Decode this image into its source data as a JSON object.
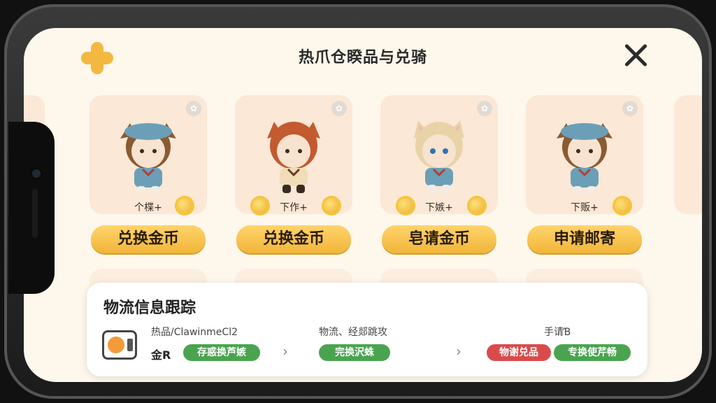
{
  "header": {
    "title": "热爪仓睽品与兑骑"
  },
  "cards": [
    {
      "coin_label": "个楪+",
      "button_label": "兑换金币",
      "hair": "#8a5a33",
      "hat": true
    },
    {
      "coin_label": "下作+",
      "button_label": "兑换金币",
      "hair": "#c35a30",
      "hat": false
    },
    {
      "coin_label": "下嫉+",
      "button_label": "皂请金币",
      "hair": "#e8d3a8",
      "hat": false
    },
    {
      "coin_label": "下贩+",
      "button_label": "申请邮寄",
      "hair": "#8a5a33",
      "hat": true
    }
  ],
  "tracking": {
    "title": "物流信息跟踪",
    "step1_text": "热品/ClawinmeCl2",
    "step1_label": "金R",
    "step1_tag": "存惑换芦嫉",
    "step2_text": "物流、经郯跳攻",
    "step2_tag": "完换沢蛛",
    "step3_text": "手请Ɓ",
    "step3_tag_red": "物谢兑品",
    "step3_tag_green": "专换使芹畅"
  },
  "colors": {
    "accent": "#f2b840",
    "button": "#f1b53a",
    "green": "#4aa44f",
    "red": "#d94b4b",
    "card_bg": "#fbe8d6"
  },
  "icons": {
    "add": "plus-icon",
    "close": "close-icon",
    "chevron": "chevron-right-icon",
    "package": "package-icon",
    "coin": "coin-icon"
  }
}
